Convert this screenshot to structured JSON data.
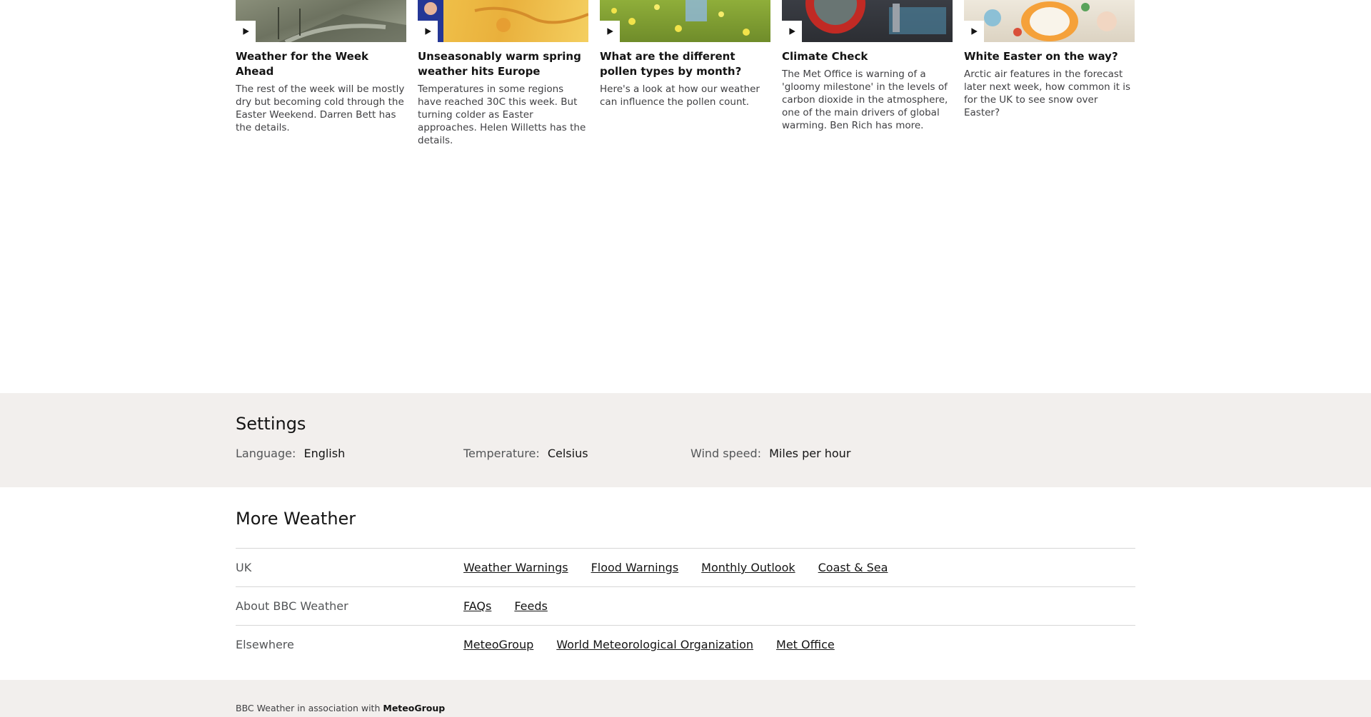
{
  "videos": [
    {
      "title": "Weather for the Week Ahead",
      "description": "The rest of the week will be mostly dry but becoming cold through the Easter Weekend. Darren Bett has the details.",
      "thumb_colors": [
        "#7c8169",
        "#9aa08d",
        "#5e6452"
      ]
    },
    {
      "title": "Unseasonably warm spring weather hits Europe",
      "description": "Temperatures in some regions have reached 30C this week. But turning colder as Easter approaches. Helen Willetts has the details.",
      "thumb_colors": [
        "#2a3a9c",
        "#f1c54a",
        "#e8a93a"
      ]
    },
    {
      "title": "What are the different pollen types by month?",
      "description": "Here's a look at how our weather can influence the pollen count.",
      "thumb_colors": [
        "#6e8c2a",
        "#e4d43e",
        "#a9c24c"
      ]
    },
    {
      "title": "Climate Check",
      "description": "The Met Office is warning of a 'gloomy milestone' in the levels of carbon dioxide in the atmosphere, one of the main drivers of global warming. Ben Rich has more.",
      "thumb_colors": [
        "#3c3f46",
        "#c8302a",
        "#2fa8a8"
      ]
    },
    {
      "title": "White Easter on the way?",
      "description": "Arctic air features in the forecast later next week, how common it is for the UK to see snow over Easter?",
      "thumb_colors": [
        "#e7e0d2",
        "#f3a23b",
        "#8cc0d6"
      ]
    }
  ],
  "settings": {
    "title": "Settings",
    "language_label": "Language:",
    "language_value": "English",
    "temperature_label": "Temperature:",
    "temperature_value": "Celsius",
    "wind_label": "Wind speed:",
    "wind_value": "Miles per hour"
  },
  "more_weather": {
    "title": "More Weather",
    "rows": [
      {
        "label": "UK",
        "links": [
          "Weather Warnings",
          "Flood Warnings",
          "Monthly Outlook",
          "Coast & Sea"
        ]
      },
      {
        "label": "About BBC Weather",
        "links": [
          "FAQs",
          "Feeds"
        ]
      },
      {
        "label": "Elsewhere",
        "links": [
          "MeteoGroup",
          "World Meteorological Organization",
          "Met Office"
        ]
      }
    ]
  },
  "footer": {
    "association_text": "BBC Weather in association with",
    "association_brand": "MeteoGroup"
  },
  "colors": {
    "settings_bg": "#f2efed",
    "text_primary": "#141414",
    "text_secondary": "#545658",
    "divider": "#d6d6d6"
  },
  "icons": {
    "play": "play-icon"
  }
}
